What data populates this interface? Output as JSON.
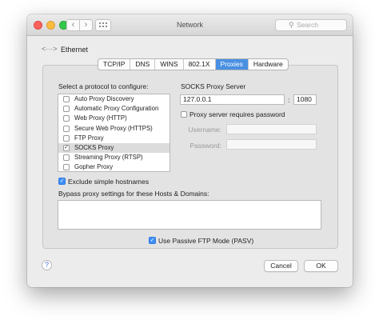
{
  "window": {
    "title": "Network"
  },
  "toolbar": {
    "back_icon": "chevron-left-icon",
    "forward_icon": "chevron-right-icon",
    "grid_icon": "grid-icon",
    "search_placeholder": "Search"
  },
  "header": {
    "service_label": "Ethernet",
    "service_icon": "ethernet-icon"
  },
  "tabs": [
    {
      "label": "TCP/IP",
      "active": false
    },
    {
      "label": "DNS",
      "active": false
    },
    {
      "label": "WINS",
      "active": false
    },
    {
      "label": "802.1X",
      "active": false
    },
    {
      "label": "Proxies",
      "active": true
    },
    {
      "label": "Hardware",
      "active": false
    }
  ],
  "protocols": {
    "heading": "Select a protocol to configure:",
    "items": [
      {
        "label": "Auto Proxy Discovery",
        "checked": false,
        "selected": false
      },
      {
        "label": "Automatic Proxy Configuration",
        "checked": false,
        "selected": false
      },
      {
        "label": "Web Proxy (HTTP)",
        "checked": false,
        "selected": false
      },
      {
        "label": "Secure Web Proxy (HTTPS)",
        "checked": false,
        "selected": false
      },
      {
        "label": "FTP Proxy",
        "checked": false,
        "selected": false
      },
      {
        "label": "SOCKS Proxy",
        "checked": true,
        "selected": true
      },
      {
        "label": "Streaming Proxy (RTSP)",
        "checked": false,
        "selected": false
      },
      {
        "label": "Gopher Proxy",
        "checked": false,
        "selected": false
      }
    ]
  },
  "server": {
    "heading": "SOCKS Proxy Server",
    "host": "127.0.0.1",
    "separator": ":",
    "port": "1080",
    "requires_password_label": "Proxy server requires password",
    "requires_password_checked": false,
    "username_label": "Username:",
    "username_value": "",
    "password_label": "Password:",
    "password_value": ""
  },
  "exclude_simple": {
    "label": "Exclude simple hostnames",
    "checked": true
  },
  "bypass": {
    "label": "Bypass proxy settings for these Hosts & Domains:",
    "value": ""
  },
  "passive_ftp": {
    "label": "Use Passive FTP Mode (PASV)",
    "checked": true
  },
  "footer": {
    "help": "?",
    "cancel": "Cancel",
    "ok": "OK"
  }
}
